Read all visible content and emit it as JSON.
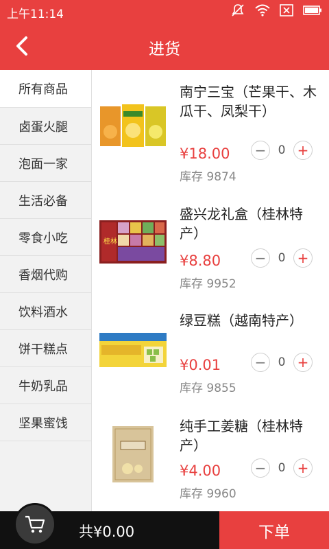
{
  "status": {
    "time": "上午11:14"
  },
  "header": {
    "title": "进货"
  },
  "sidebar": {
    "items": [
      {
        "label": "所有商品"
      },
      {
        "label": "卤蛋火腿"
      },
      {
        "label": "泡面一家"
      },
      {
        "label": "生活必备"
      },
      {
        "label": "零食小吃"
      },
      {
        "label": "香烟代购"
      },
      {
        "label": "饮料酒水"
      },
      {
        "label": "饼干糕点"
      },
      {
        "label": "牛奶乳品"
      },
      {
        "label": "坚果蜜饯"
      }
    ]
  },
  "products": [
    {
      "name": "南宁三宝（芒果干、木瓜干、凤梨干）",
      "price": "¥18.00",
      "qty": "0",
      "stock": "库存 9874"
    },
    {
      "name": "盛兴龙礼盒（桂林特产）",
      "price": "¥8.80",
      "qty": "0",
      "stock": "库存 9952"
    },
    {
      "name": "绿豆糕（越南特产）",
      "price": "¥0.01",
      "qty": "0",
      "stock": "库存 9855"
    },
    {
      "name": "纯手工姜糖（桂林特产）",
      "price": "¥4.00",
      "qty": "0",
      "stock": "库存 9960"
    }
  ],
  "footer": {
    "total": "共¥0.00",
    "order_label": "下单"
  },
  "colors": {
    "accent": "#e8403f",
    "bottom_bar": "#111111"
  },
  "icons": [
    "back-arrow-icon",
    "cart-icon",
    "mute-icon",
    "wifi-icon",
    "close-box-icon",
    "battery-icon",
    "minus-icon",
    "plus-icon"
  ]
}
